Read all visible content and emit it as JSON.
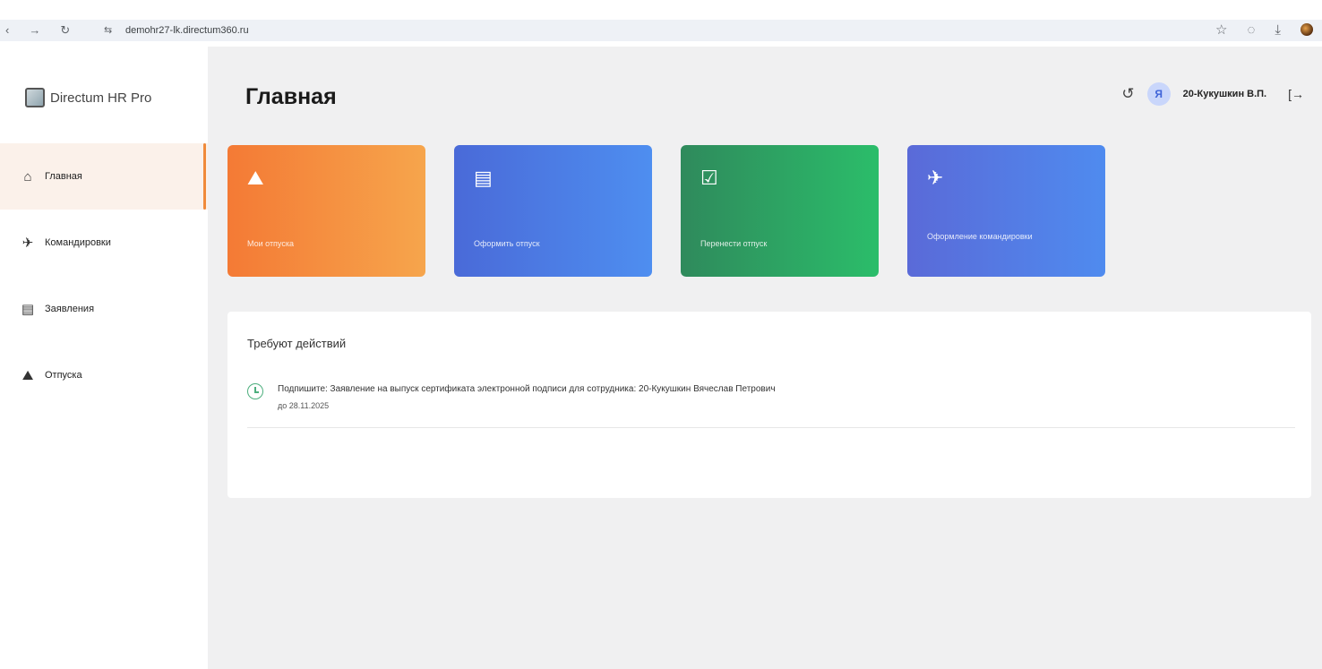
{
  "browser": {
    "url": "demohr27-lk.directum360.ru",
    "icons": [
      "back-icon",
      "forward-icon",
      "reload-icon",
      "site-settings-icon",
      "star-icon",
      "extensions-icon",
      "download-icon",
      "profile-icon"
    ]
  },
  "sidebar": {
    "logo": "Directum HR Pro",
    "items": [
      {
        "label": "Главная",
        "icon": "home-icon",
        "active": true
      },
      {
        "label": "Командировки",
        "icon": "plane-icon",
        "active": false
      },
      {
        "label": "Заявления",
        "icon": "clipboard-icon",
        "active": false
      },
      {
        "label": "Отпуска",
        "icon": "mountains-icon",
        "active": false
      }
    ]
  },
  "header": {
    "title": "Главная",
    "user_initial": "Я",
    "user_name": "20-Кукушкин В.П."
  },
  "tiles": [
    {
      "label": "Мои отпуска",
      "icon": "mountains-icon",
      "color": "#f47a35"
    },
    {
      "label": "Оформить отпуск",
      "icon": "document-icon",
      "color": "#4a6ad8"
    },
    {
      "label": "Перенести отпуск",
      "icon": "calendar-check-icon",
      "color": "#2f8a5c"
    },
    {
      "label": "Оформление командировки",
      "icon": "plane-icon",
      "color": "#5a6ad8"
    }
  ],
  "actions": {
    "title": "Требуют действий",
    "items": [
      {
        "text": "Подпишите: Заявление на выпуск сертификата электронной подписи для сотрудника: 20-Кукушкин Вячеслав Петрович",
        "due": "до 28.11.2025"
      }
    ]
  }
}
